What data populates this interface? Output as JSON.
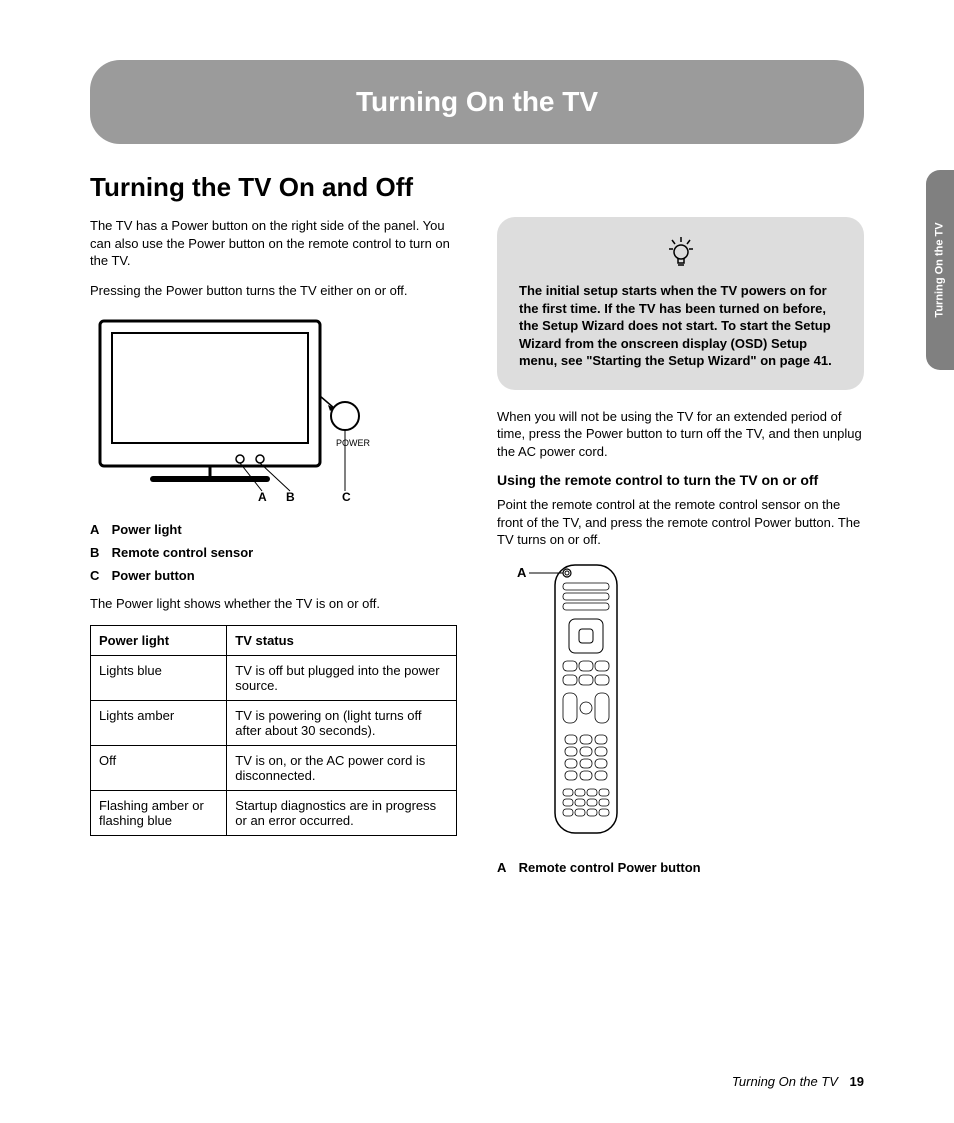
{
  "chapter_title": "Turning On the TV",
  "section_title": "Turning the TV On and Off",
  "side_tab": "Turning On the TV",
  "left": {
    "p1": "The TV has a Power button on the right side of the panel. You can also use the Power button on the remote control to turn on the TV.",
    "p2": "Pressing the Power button turns the TV either on or off.",
    "tv_labels": {
      "power": "POWER",
      "a": "A",
      "b": "B",
      "c": "C"
    },
    "legend": [
      {
        "key": "A",
        "label": "Power light"
      },
      {
        "key": "B",
        "label": "Remote control sensor"
      },
      {
        "key": "C",
        "label": "Power button"
      }
    ],
    "p3": "The Power light shows whether the TV is on or off.",
    "table": {
      "headers": [
        "Power light",
        "TV status"
      ],
      "rows": [
        [
          "Lights blue",
          "TV is off but plugged into the power source."
        ],
        [
          "Lights amber",
          "TV is powering on (light turns off after about 30 seconds)."
        ],
        [
          "Off",
          "TV is on, or the AC power cord is disconnected."
        ],
        [
          "Flashing amber or flashing blue",
          "Startup diagnostics are in progress or an error occurred."
        ]
      ]
    }
  },
  "right": {
    "tip": "The initial setup starts when the TV powers on for the first time. If the TV has been turned on before, the Setup Wizard does not start. To start the Setup Wizard from the onscreen display (OSD) Setup menu, see \"Starting the Setup Wizard\" on page 41.",
    "p1": "When you will not be using the TV for an extended period of time, press the Power button to turn off the TV, and then unplug the AC power cord.",
    "sub_heading": "Using the remote control to turn the TV on or off",
    "p2": "Point the remote control at the remote control sensor on the front of the TV, and press the remote control Power button. The TV turns on or off.",
    "remote_label": "A",
    "remote_legend": {
      "key": "A",
      "label": "Remote control Power button"
    }
  },
  "footer": {
    "title": "Turning On the TV",
    "page": "19"
  }
}
